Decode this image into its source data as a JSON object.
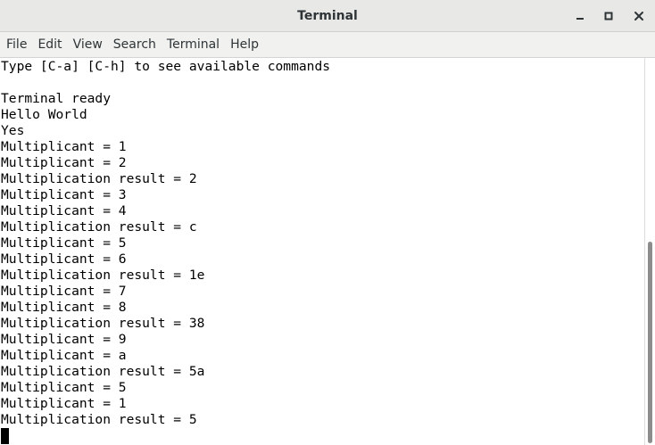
{
  "window": {
    "title": "Terminal"
  },
  "menubar": {
    "items": [
      "File",
      "Edit",
      "View",
      "Search",
      "Terminal",
      "Help"
    ]
  },
  "terminal": {
    "lines": [
      "Type [C-a] [C-h] to see available commands",
      "",
      "Terminal ready",
      "Hello World",
      "Yes",
      "Multiplicant = 1",
      "Multiplicant = 2",
      "Multiplication result = 2",
      "Multiplicant = 3",
      "Multiplicant = 4",
      "Multiplication result = c",
      "Multiplicant = 5",
      "Multiplicant = 6",
      "Multiplication result = 1e",
      "Multiplicant = 7",
      "Multiplicant = 8",
      "Multiplication result = 38",
      "Multiplicant = 9",
      "Multiplicant = a",
      "Multiplication result = 5a",
      "Multiplicant = 5",
      "Multiplicant = 1",
      "Multiplication result = 5"
    ]
  },
  "icons": {
    "minimize": "minimize-icon",
    "maximize": "maximize-icon",
    "close": "close-icon"
  },
  "colors": {
    "titlebar": "#e8e8e7",
    "menubar": "#f1f1f0",
    "text": "#000000",
    "scroll_thumb": "#8c8c8c"
  }
}
